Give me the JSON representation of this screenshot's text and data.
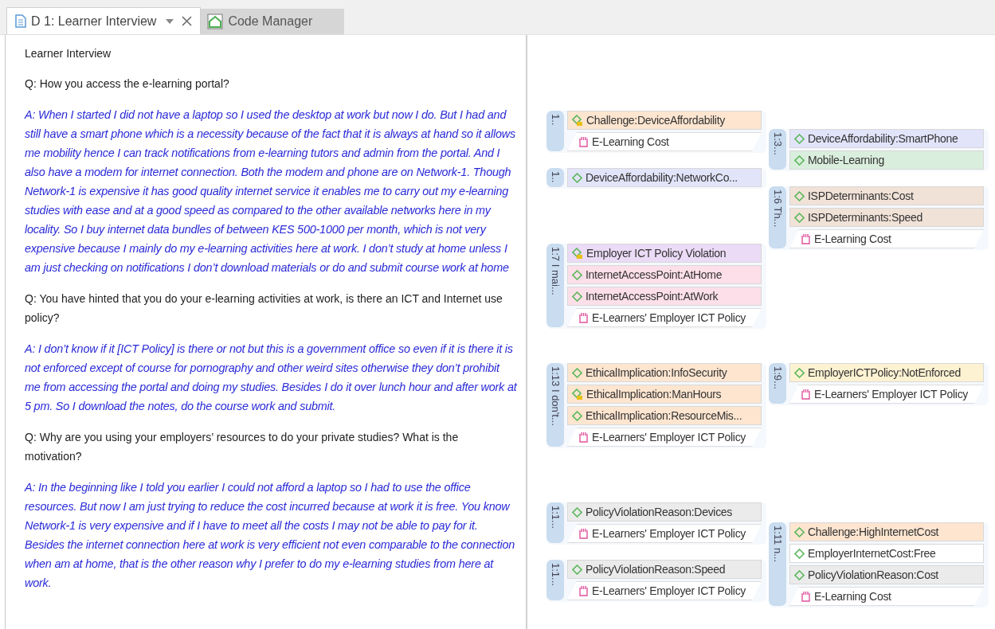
{
  "tabs": [
    {
      "label": "D 1: Learner Interview",
      "kind": "document",
      "selected": true
    },
    {
      "label": "Code Manager",
      "kind": "manager",
      "selected": false
    }
  ],
  "document": {
    "title": "Learner Interview",
    "paragraphs": [
      {
        "kind": "question",
        "text": "Q: How you access the e-learning portal?"
      },
      {
        "kind": "answer",
        "text": "A: When I started I did not have a laptop so I used the desktop at work but now I do. But I had and still have a smart phone which is a necessity because of the fact that it is always at hand so it allows me mobility hence I can track notifications from e-learning tutors and admin from the portal. And I also have a modem for internet connection. Both the modem and phone are on Network-1. Though Network-1 is expensive it has good quality internet service it enables me to carry out my e-learning studies with ease and at a good speed as compared to the other available networks here in my locality. So I buy internet data bundles of between KES 500-1000 per month, which is not very expensive because I mainly do my e-learning activities here at work. I don’t study at home unless I am just checking on notifications I don’t download materials or do and submit course work at home"
      },
      {
        "kind": "question",
        "text": "Q: You have hinted that you do your e-learning activities at work, is there an ICT and Internet use policy?"
      },
      {
        "kind": "answer",
        "text": "A: I don’t know if it [ICT Policy]  is there or not but this is a government office so even if it is there it is not enforced except of course for pornography and other weird sites otherwise they don’t prohibit me from accessing the portal and doing my studies. Besides I do it over lunch hour and after work at 5 pm. So I download the notes, do the course work and submit."
      },
      {
        "kind": "question",
        "text": "Q: Why are you using your employers’ resources to do your private studies? What is the motivation?"
      },
      {
        "kind": "answer",
        "text": "A: In the beginning like I told you earlier I could not afford a laptop so I had to use the office resources. But now I am just trying to reduce the cost incurred because at work it is free. You know Network-1 is very expensive and if I have to meet all the costs I may not be able to pay for it. Besides the internet connection here at work is very efficient not even comparable to the connection when am at home, that is the other reason why I prefer to do my e-learning studies from here at work."
      }
    ]
  },
  "quotations": [
    {
      "label": "1..",
      "items": [
        {
          "kind": "code",
          "memo": true,
          "label": "Challenge:DeviceAffordability",
          "color": "#fde5d0"
        },
        {
          "kind": "group",
          "label": "E-Learning Cost"
        }
      ]
    },
    {
      "label": "1:3...",
      "items": [
        {
          "kind": "code",
          "memo": false,
          "label": "DeviceAffordability:SmartPhone",
          "color": "#e2e4fa"
        },
        {
          "kind": "code",
          "memo": false,
          "label": "Mobile-Learning",
          "color": "#daeedd"
        }
      ]
    },
    {
      "label": "1..",
      "items": [
        {
          "kind": "code",
          "memo": false,
          "label": "DeviceAffordability:NetworkCo...",
          "color": "#e2e4fa"
        }
      ]
    },
    {
      "label": "1:6 Th...",
      "items": [
        {
          "kind": "code",
          "memo": false,
          "label": "ISPDeterminants:Cost",
          "color": "#f1e2d8"
        },
        {
          "kind": "code",
          "memo": false,
          "label": "ISPDeterminants:Speed",
          "color": "#f1e2d8"
        },
        {
          "kind": "group",
          "label": "E-Learning Cost"
        }
      ]
    },
    {
      "label": "1:7 I mai...",
      "items": [
        {
          "kind": "code",
          "memo": true,
          "label": "Employer ICT Policy Violation",
          "color": "#ebdbf6"
        },
        {
          "kind": "code",
          "memo": false,
          "label": "InternetAccessPoint:AtHome",
          "color": "#fcdfe9"
        },
        {
          "kind": "code",
          "memo": false,
          "label": "InternetAccessPoint:AtWork",
          "color": "#fcdfe9"
        },
        {
          "kind": "group",
          "label": "E-Learners' Employer ICT Policy"
        }
      ]
    },
    {
      "label": "1:13 I don't...",
      "items": [
        {
          "kind": "code",
          "memo": false,
          "label": "EthicalImplication:InfoSecurity",
          "color": "#fde5d0"
        },
        {
          "kind": "code",
          "memo": true,
          "label": "EthicalImplication:ManHours",
          "color": "#fde5d0"
        },
        {
          "kind": "code",
          "memo": false,
          "label": "EthicalImplication:ResourceMis...",
          "color": "#fde5d0"
        },
        {
          "kind": "group",
          "label": "E-Learners' Employer ICT Policy"
        }
      ]
    },
    {
      "label": "1:9...",
      "items": [
        {
          "kind": "code",
          "memo": false,
          "label": "EmployerICTPolicy:NotEnforced",
          "color": "#fdf2d2"
        },
        {
          "kind": "group",
          "label": "E-Learners' Employer ICT Policy"
        }
      ]
    },
    {
      "label": "1:1...",
      "items": [
        {
          "kind": "code",
          "memo": false,
          "label": "PolicyViolationReason:Devices",
          "color": "#ebebeb"
        },
        {
          "kind": "group",
          "label": "E-Learners' Employer ICT Policy"
        }
      ]
    },
    {
      "label": "1:1...",
      "items": [
        {
          "kind": "code",
          "memo": false,
          "label": "PolicyViolationReason:Speed",
          "color": "#ebebeb"
        },
        {
          "kind": "group",
          "label": "E-Learners' Employer ICT Policy"
        }
      ]
    },
    {
      "label": "1:11 n...",
      "items": [
        {
          "kind": "code",
          "memo": false,
          "label": "Challenge:HighInternetCost",
          "color": "#fde5d0"
        },
        {
          "kind": "code",
          "memo": false,
          "label": "EmployerInternetCost:Free",
          "color": "#ffffff"
        },
        {
          "kind": "code",
          "memo": false,
          "label": "PolicyViolationReason:Cost",
          "color": "#ebebeb"
        },
        {
          "kind": "group",
          "label": "E-Learning Cost"
        }
      ]
    }
  ]
}
